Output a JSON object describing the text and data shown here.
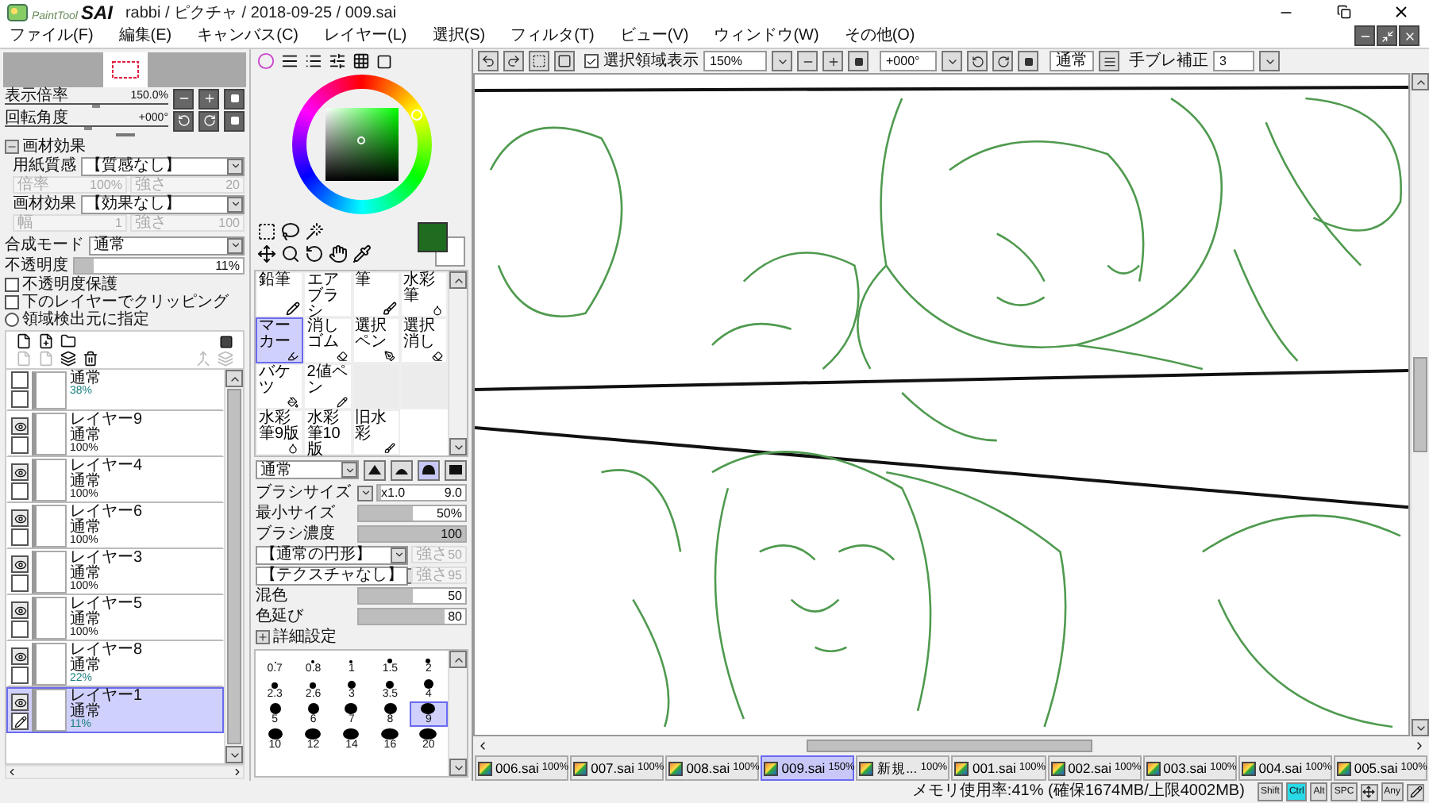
{
  "window": {
    "logo_small": "PaintTool",
    "logo_big": "SAI",
    "title": "rabbi / ピクチャ / 2018-09-25 / 009.sai"
  },
  "menu": [
    "ファイル(F)",
    "編集(E)",
    "キャンバス(C)",
    "レイヤー(L)",
    "選択(S)",
    "フィルタ(T)",
    "ビュー(V)",
    "ウィンドウ(W)",
    "その他(O)"
  ],
  "toolbar": {
    "selection_display": {
      "label": "選択領域表示",
      "checked": true
    },
    "zoom": "150%",
    "angle": "+000°",
    "blend": "通常",
    "stabilizer_label": "手ブレ補正",
    "stabilizer": "3"
  },
  "navigator": {
    "zoom": {
      "label": "表示倍率",
      "value": "150.0%",
      "level": 0.55
    },
    "angle": {
      "label": "回転角度",
      "value": "+000°",
      "level": 0.5
    }
  },
  "texture": {
    "title": "画材効果",
    "expanded": true,
    "rows": [
      {
        "label": "用紙質感",
        "value": "【質感なし】",
        "params": [
          {
            "label": "倍率",
            "value": "100%",
            "disabled": true
          },
          {
            "label": "強さ",
            "value": "20",
            "disabled": true
          }
        ]
      },
      {
        "label": "画材効果",
        "value": "【効果なし】",
        "params": [
          {
            "label": "幅",
            "value": "1",
            "disabled": true
          },
          {
            "label": "強さ",
            "value": "100",
            "disabled": true
          }
        ]
      }
    ]
  },
  "layer_props": {
    "blend_label": "合成モード",
    "blend": "通常",
    "opacity_label": "不透明度",
    "opacity": {
      "value": "11%",
      "level": 0.11
    },
    "checks": [
      {
        "label": "不透明度保護",
        "checked": false
      },
      {
        "label": "下のレイヤーでクリッピング",
        "checked": false
      }
    ],
    "radio": {
      "label": "領域検出元に指定",
      "selected": false
    }
  },
  "layers": [
    {
      "blend": "通常",
      "opacity": "38%",
      "partial": true,
      "visible": false,
      "selected": false
    },
    {
      "name": "レイヤー9",
      "blend": "通常",
      "opacity": "100%",
      "partial": false,
      "visible": true,
      "selected": false
    },
    {
      "name": "レイヤー4",
      "blend": "通常",
      "opacity": "100%",
      "partial": false,
      "visible": true,
      "selected": false
    },
    {
      "name": "レイヤー6",
      "blend": "通常",
      "opacity": "100%",
      "partial": false,
      "visible": true,
      "selected": false
    },
    {
      "name": "レイヤー3",
      "blend": "通常",
      "opacity": "100%",
      "partial": false,
      "visible": true,
      "selected": false
    },
    {
      "name": "レイヤー5",
      "blend": "通常",
      "opacity": "100%",
      "partial": false,
      "visible": true,
      "selected": false
    },
    {
      "name": "レイヤー8",
      "blend": "通常",
      "opacity": "22%",
      "partial": true,
      "visible": true,
      "selected": false
    },
    {
      "name": "レイヤー1",
      "blend": "通常",
      "opacity": "11%",
      "partial": true,
      "visible": true,
      "selected": true
    }
  ],
  "tools": [
    {
      "label": "鉛筆",
      "selected": false
    },
    {
      "label": "エアブラシ",
      "selected": false
    },
    {
      "label": "筆",
      "selected": false
    },
    {
      "label": "水彩筆",
      "selected": false
    },
    {
      "label": "マーカー",
      "selected": true
    },
    {
      "label": "消しゴム",
      "selected": false
    },
    {
      "label": "選択ペン",
      "selected": false
    },
    {
      "label": "選択消し",
      "selected": false
    },
    {
      "label": "バケツ",
      "selected": false
    },
    {
      "label": "2値ペン",
      "selected": false
    },
    {
      "label": "水彩筆9版",
      "selected": false
    },
    {
      "label": "水彩筆10版",
      "selected": false
    },
    {
      "label": "旧水彩",
      "selected": false
    }
  ],
  "brush": {
    "blend": "通常",
    "shapes": [
      {
        "selected": false
      },
      {
        "selected": false
      },
      {
        "selected": true
      },
      {
        "selected": false
      }
    ],
    "settings": [
      {
        "kind": "size",
        "label": "ブラシサイズ",
        "multiplier": "x1.0",
        "value": "9.0",
        "level": 0.04
      },
      {
        "kind": "slider",
        "label": "最小サイズ",
        "value": "50%",
        "level": 0.5
      },
      {
        "kind": "slider",
        "label": "ブラシ濃度",
        "value": "100",
        "level": 1
      },
      {
        "kind": "shape",
        "value": "【通常の円形】",
        "strength_label": "強さ",
        "strength": "50",
        "disabled": true
      },
      {
        "kind": "shape",
        "value": "【テクスチャなし】",
        "strength_label": "強さ",
        "strength": "95",
        "disabled": true
      },
      {
        "kind": "slider",
        "label": "混色",
        "value": "50",
        "level": 0.5
      },
      {
        "kind": "slider",
        "label": "色延び",
        "value": "80",
        "level": 0.8
      }
    ],
    "detail_label": "詳細設定",
    "sizes": [
      {
        "label": "0.7",
        "selected": false
      },
      {
        "label": "0.8",
        "selected": false
      },
      {
        "label": "1",
        "selected": false
      },
      {
        "label": "1.5",
        "selected": false
      },
      {
        "label": "2",
        "selected": false
      },
      {
        "label": "2.3",
        "selected": false
      },
      {
        "label": "2.6",
        "selected": false
      },
      {
        "label": "3",
        "selected": false
      },
      {
        "label": "3.5",
        "selected": false
      },
      {
        "label": "4",
        "selected": false
      },
      {
        "label": "5",
        "selected": false
      },
      {
        "label": "6",
        "selected": false
      },
      {
        "label": "7",
        "selected": false
      },
      {
        "label": "8",
        "selected": false
      },
      {
        "label": "9",
        "selected": true
      },
      {
        "label": "10",
        "selected": false
      },
      {
        "label": "12",
        "selected": false
      },
      {
        "label": "14",
        "selected": false
      },
      {
        "label": "16",
        "selected": false
      },
      {
        "label": "20",
        "selected": false
      }
    ]
  },
  "tabs": [
    {
      "name": "006.sai",
      "zoom": "100%",
      "selected": false
    },
    {
      "name": "007.sai",
      "zoom": "100%",
      "selected": false
    },
    {
      "name": "008.sai",
      "zoom": "100%",
      "selected": false
    },
    {
      "name": "009.sai",
      "zoom": "150%",
      "selected": true
    },
    {
      "name": "新規...",
      "zoom": "100%",
      "selected": false
    },
    {
      "name": "001.sai",
      "zoom": "100%",
      "selected": false
    },
    {
      "name": "002.sai",
      "zoom": "100%",
      "selected": false
    },
    {
      "name": "003.sai",
      "zoom": "100%",
      "selected": false
    },
    {
      "name": "004.sai",
      "zoom": "100%",
      "selected": false
    },
    {
      "name": "005.sai",
      "zoom": "100%",
      "selected": false
    }
  ],
  "status_bar": {
    "memory": "メモリ使用率:41% (確保1674MB/上限4002MB)",
    "keys": [
      {
        "label": "Shift",
        "on": false
      },
      {
        "label": "Ctrl",
        "on": true
      },
      {
        "label": "Alt",
        "on": false
      },
      {
        "label": "SPC",
        "on": false
      },
      {
        "label": "Any",
        "on": false
      }
    ]
  }
}
